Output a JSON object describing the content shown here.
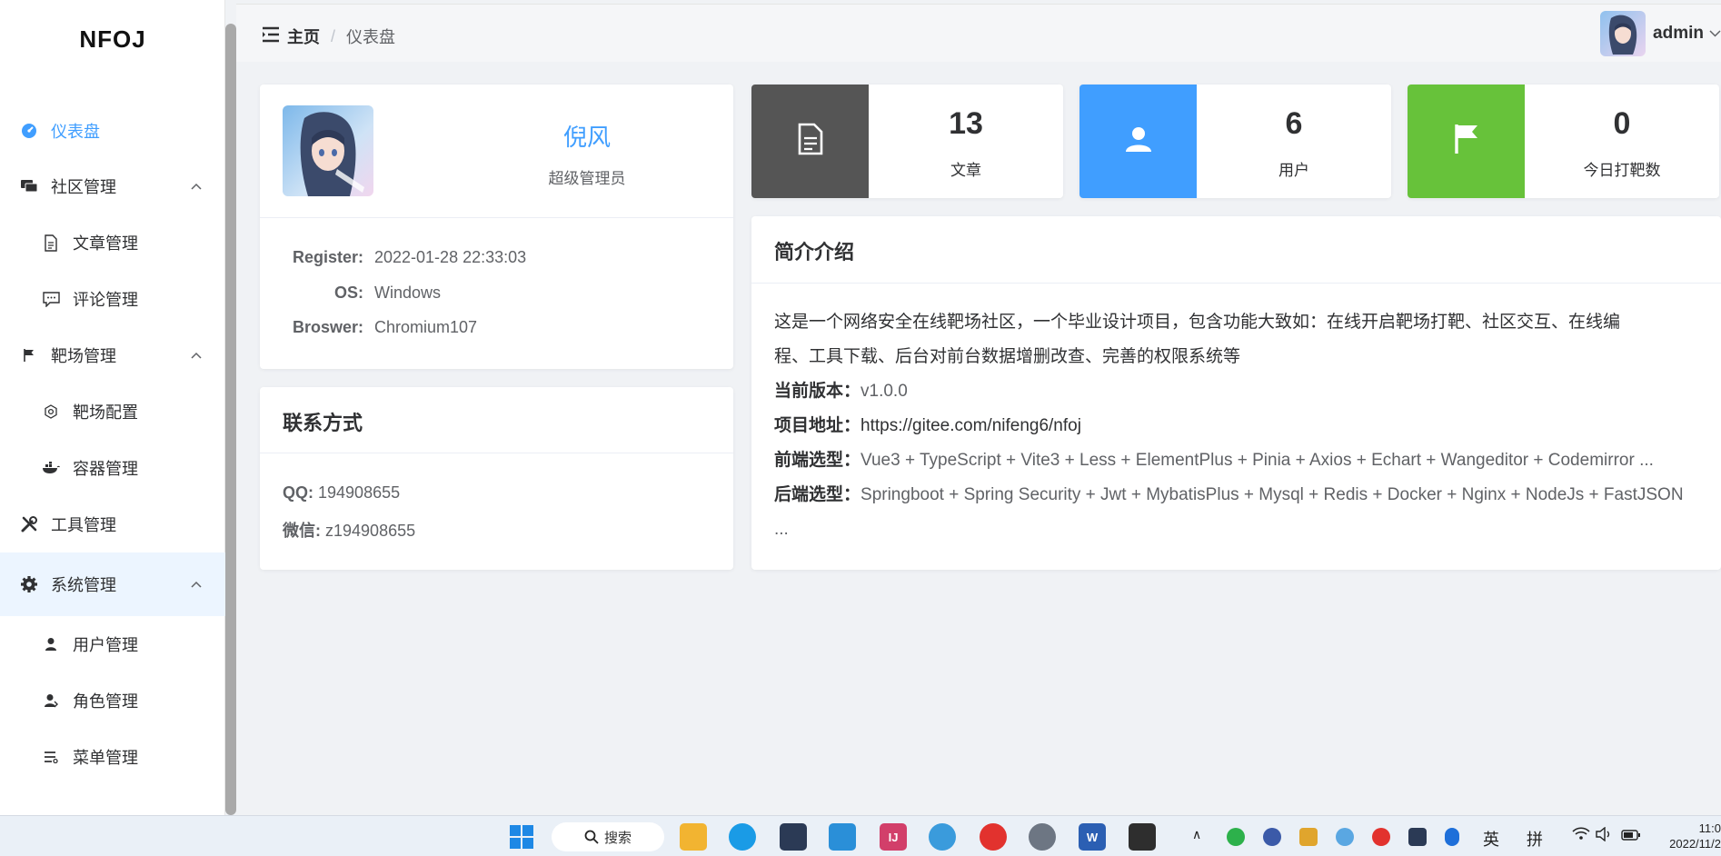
{
  "app": {
    "logo": "NFOJ"
  },
  "sidebar": {
    "items": [
      {
        "label": "仪表盘",
        "icon": "dashboard-icon"
      },
      {
        "label": "社区管理",
        "icon": "chat-icon"
      },
      {
        "label": "文章管理",
        "icon": "document-icon"
      },
      {
        "label": "评论管理",
        "icon": "comment-icon"
      },
      {
        "label": "靶场管理",
        "icon": "flag-icon"
      },
      {
        "label": "靶场配置",
        "icon": "settings-icon"
      },
      {
        "label": "容器管理",
        "icon": "docker-icon"
      },
      {
        "label": "工具管理",
        "icon": "tools-icon"
      },
      {
        "label": "系统管理",
        "icon": "gear-icon"
      },
      {
        "label": "用户管理",
        "icon": "user-icon"
      },
      {
        "label": "角色管理",
        "icon": "user-role-icon"
      },
      {
        "label": "菜单管理",
        "icon": "menu-list-icon"
      }
    ]
  },
  "header": {
    "breadcrumb_home": "主页",
    "breadcrumb_sep": "/",
    "breadcrumb_current": "仪表盘",
    "username": "admin"
  },
  "profile": {
    "name": "倪风",
    "role": "超级管理员",
    "register_label": "Register:",
    "register_value": "2022-01-28 22:33:03",
    "os_label": "OS:",
    "os_value": "Windows",
    "browser_label": "Broswer:",
    "browser_value": "Chromium107"
  },
  "contact": {
    "title": "联系方式",
    "qq_label": "QQ:",
    "qq_value": "194908655",
    "wechat_label": "微信:",
    "wechat_value": "z194908655"
  },
  "stats": [
    {
      "value": "13",
      "label": "文章",
      "color": "#555555",
      "icon": "document-icon"
    },
    {
      "value": "6",
      "label": "用户",
      "color": "#409eff",
      "icon": "user-icon"
    },
    {
      "value": "0",
      "label": "今日打靶数",
      "color": "#67c23a",
      "icon": "flag-icon"
    }
  ],
  "intro": {
    "title": "简介介绍",
    "desc_line1": "这是一个网络安全在线靶场社区，一个毕业设计项目，包含功能大致如：在线开启靶场打靶、社区交互、在线编",
    "desc_line2": "程、工具下载、后台对前台数据增删改查、完善的权限系统等",
    "version_label": "当前版本：",
    "version_value": "v1.0.0",
    "repo_label": "项目地址：",
    "repo_value": "https://gitee.com/nifeng6/nfoj",
    "frontend_label": "前端选型：",
    "frontend_value": "Vue3 + TypeScript + Vite3 + Less + ElementPlus + Pinia + Axios + Echart + Wangeditor + Codemirror ...",
    "backend_label": "后端选型：",
    "backend_value": "Springboot + Spring Security + Jwt + MybatisPlus + Mysql + Redis + Docker + Nginx + NodeJs + FastJSON",
    "backend_more": "..."
  },
  "taskbar": {
    "search_label": "搜索",
    "ime_lang": "英",
    "ime_mode": "拼",
    "time": "11:0",
    "date": "2022/11/2"
  },
  "colors": {
    "accent": "#409eff",
    "success": "#67c23a",
    "dark": "#555555"
  }
}
